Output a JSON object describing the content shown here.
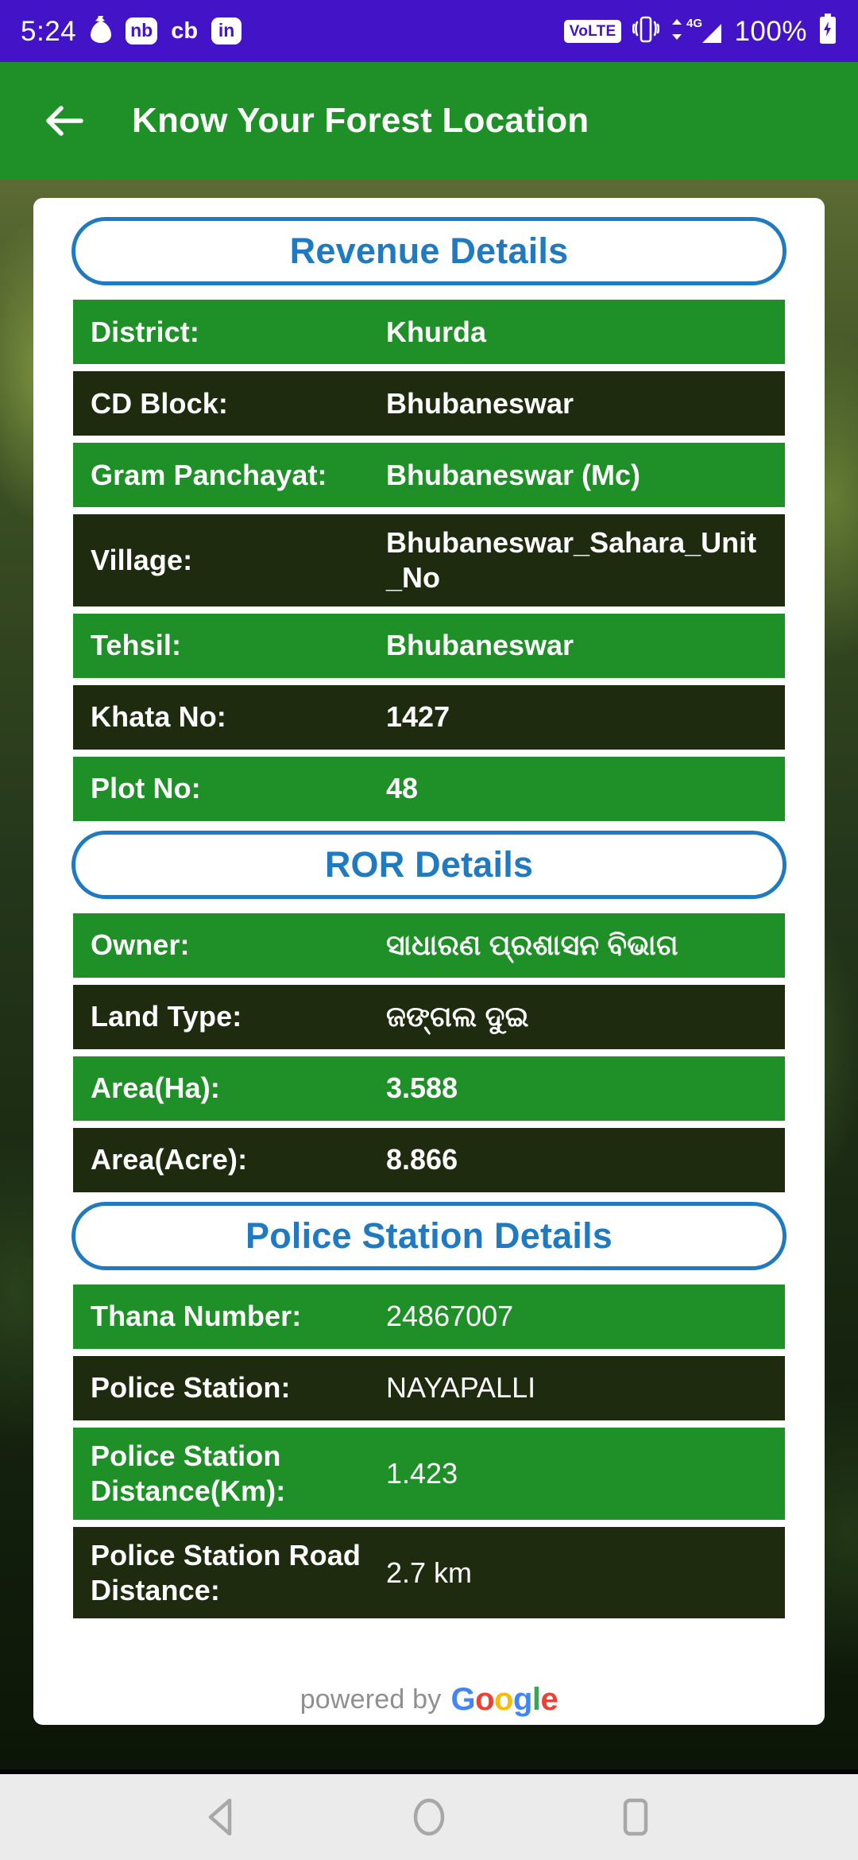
{
  "statusbar": {
    "time": "5:24",
    "icons_left": [
      "money-bag-icon",
      "nb-app-icon",
      "cb-app-icon",
      "linkedin-icon"
    ],
    "nb_label": "nb",
    "cb_label": "cb",
    "in_label": "in",
    "volte_label": "VoLTE",
    "network_label": "4G",
    "battery_percent": "100%",
    "icons_right": [
      "volte-icon",
      "vibrate-icon",
      "signal-4g-icon",
      "battery-charging-icon"
    ],
    "bg_color": "#4313c8"
  },
  "appbar": {
    "title": "Know Your Forest Location",
    "back_icon": "back-arrow-icon",
    "bg_color": "#1f9028"
  },
  "sections": [
    {
      "title": "Revenue Details",
      "rows": [
        {
          "label": "District:",
          "value": "Khurda"
        },
        {
          "label": "CD Block:",
          "value": "Bhubaneswar"
        },
        {
          "label": "Gram Panchayat:",
          "value": "Bhubaneswar (Mc)"
        },
        {
          "label": "Village:",
          "value": "Bhubaneswar_Sahara_Unit_No"
        },
        {
          "label": "Tehsil:",
          "value": "Bhubaneswar"
        },
        {
          "label": "Khata No:",
          "value": "1427"
        },
        {
          "label": "Plot No:",
          "value": "48"
        }
      ]
    },
    {
      "title": "ROR Details",
      "rows": [
        {
          "label": "Owner:",
          "value": "ସାଧାରଣ ପ୍ରଶାସନ ବିଭାଗ"
        },
        {
          "label": "Land Type:",
          "value": "ଜଙ୍ଗଲ ଦୁଇ"
        },
        {
          "label": "Area(Ha):",
          "value": "3.588"
        },
        {
          "label": "Area(Acre):",
          "value": "8.866"
        }
      ]
    },
    {
      "title": "Police Station Details",
      "rows": [
        {
          "label": "Thana Number:",
          "value": "24867007"
        },
        {
          "label": "Police Station:",
          "value": "NAYAPALLI"
        },
        {
          "label": "Police Station Distance(Km):",
          "value": "1.423"
        },
        {
          "label": "Police Station Road Distance:",
          "value": "2.7 km"
        }
      ]
    }
  ],
  "footer": {
    "powered_by": "powered by",
    "google": {
      "g1": "G",
      "o1": "o",
      "o2": "o",
      "g2": "g",
      "l": "l",
      "e": "e"
    }
  },
  "navbar": {
    "back": "nav-back-icon",
    "home": "nav-home-icon",
    "recents": "nav-recents-icon"
  },
  "colors": {
    "accent_blue": "#1f7ac0",
    "row_green": "#1f9028",
    "row_dark": "#1e2b0e",
    "status_purple": "#4313c8"
  }
}
